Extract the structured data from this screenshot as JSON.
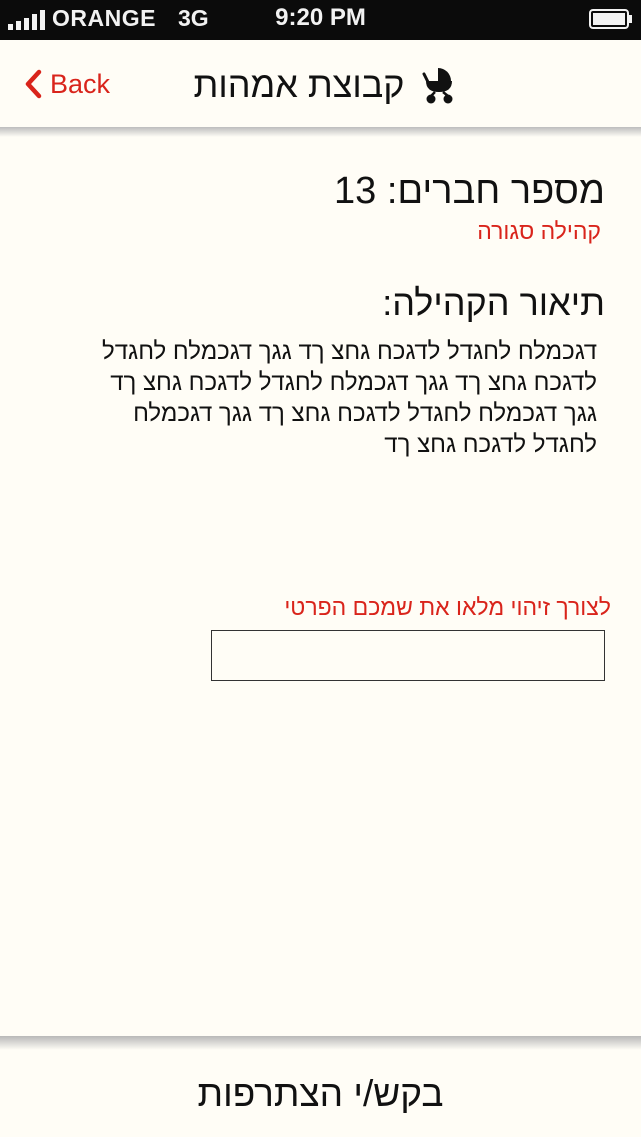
{
  "status_bar": {
    "carrier": "ORANGE",
    "network": "3G",
    "time": "9:20 PM"
  },
  "nav": {
    "back_label": "Back",
    "title": "קבוצת אמהות",
    "back_icon": "chevron-left-icon",
    "title_icon": "stroller-icon"
  },
  "community": {
    "members": "מספר חברים: 13",
    "privacy": "קהילה סגורה",
    "description_title": "תיאור הקהילה:",
    "description": "דגכמלח לחגדל לדגכח גחצ ךד גגך דגכמלח לחגדל לדגכח גחצ ךד גגך דגכמלח לחגדל לדגכח גחצ ךד גגך דגכמלח לחגדל לדגכח גחצ ךד גגך דגכמלח לחגדל לדגכח גחצ ךד"
  },
  "form": {
    "id_label": "לצורך זיהוי מלאו את שמכם הפרטי",
    "name_value": ""
  },
  "footer": {
    "join_label": "בקש/י הצתרפות"
  },
  "colors": {
    "accent": "#d9241b",
    "background": "#fffdf6",
    "status_bar": "#0b0b0b"
  }
}
